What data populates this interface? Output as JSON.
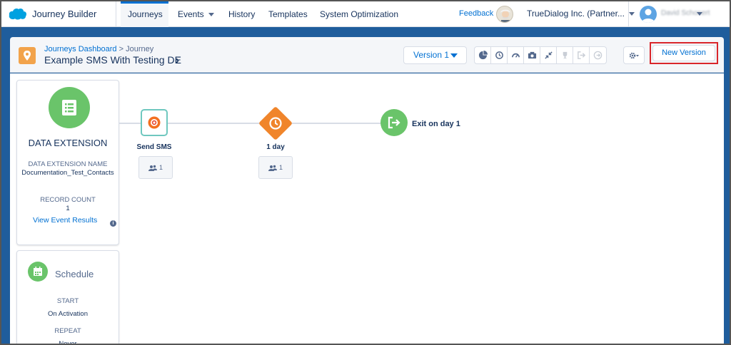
{
  "topnav": {
    "app_title": "Journey Builder",
    "tabs": [
      {
        "label": "Journeys",
        "active": true
      },
      {
        "label": "Events",
        "has_dropdown": true
      },
      {
        "label": "History"
      },
      {
        "label": "Templates"
      },
      {
        "label": "System Optimization"
      }
    ],
    "feedback": "Feedback",
    "org_name": "TrueDialog Inc. (Partner...",
    "user_name": "David Schonert"
  },
  "header": {
    "breadcrumb_link": "Journeys Dashboard",
    "breadcrumb_sep": ">",
    "breadcrumb_current": "Journey",
    "journey_name": "Example SMS With Testing DE",
    "version_label": "Version 1",
    "new_version_label": "New Version",
    "toolbar_icons": [
      "pie-chart-icon",
      "history-icon",
      "gauge-icon",
      "camera-icon",
      "collapse-icon",
      "trophy-icon",
      "exit-icon",
      "exit-alt-icon"
    ]
  },
  "data_extension": {
    "title": "DATA EXTENSION",
    "name_label": "DATA EXTENSION NAME",
    "name_value": "Documentation_Test_Contacts",
    "count_label": "RECORD COUNT",
    "count_value": "1",
    "results_link": "View Event Results",
    "info_glyph": "i"
  },
  "schedule": {
    "title": "Schedule",
    "start_label": "START",
    "start_value": "On Activation",
    "repeat_label": "REPEAT",
    "repeat_value": "Never"
  },
  "flow": {
    "sms_label": "Send SMS",
    "sms_count": "1",
    "wait_label": "1 day",
    "wait_count": "1",
    "exit_label": "Exit on day 1"
  },
  "colors": {
    "accent": "#0070d2",
    "band": "#1f5d9c",
    "green": "#6ac46a",
    "orange": "#f0852b",
    "teal": "#6fc8bf",
    "highlight": "#d9262b"
  }
}
